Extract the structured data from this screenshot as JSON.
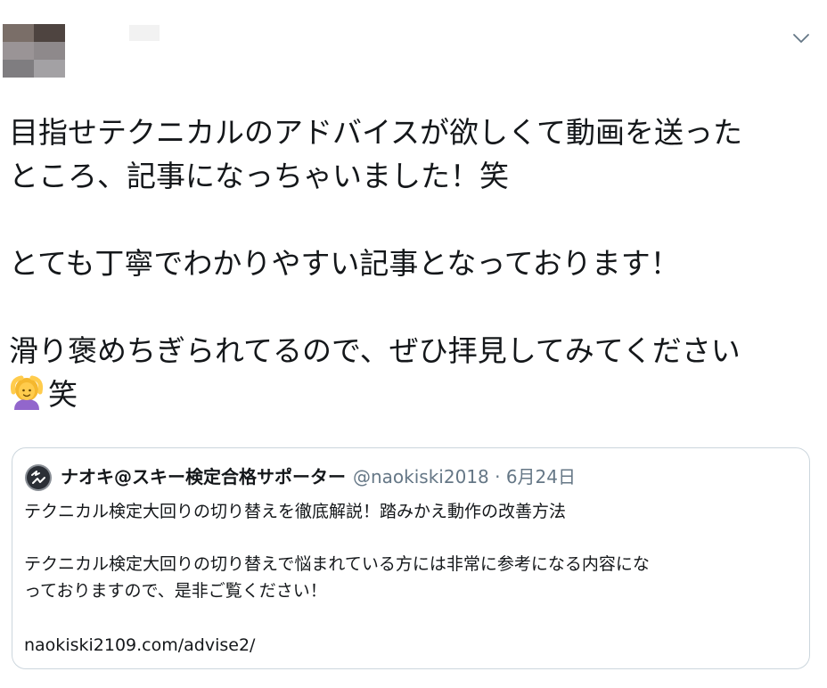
{
  "tweet": {
    "body": {
      "line1": "目指せテクニカルのアドバイスが欲しくて動画を送った",
      "line2": "ところ、記事になっちゃいました！笑",
      "line3": "とても丁寧でわかりやすい記事となっております！",
      "line4": "滑り褒めちぎられてるので、ぜひ拝見してみてください",
      "line5_text": "笑",
      "line5_emoji": "person-gesturing-ok-emoji"
    },
    "menu_icon": "chevron-down-icon",
    "colors": {
      "text": "#14171a",
      "secondary": "#657786",
      "border": "#ccd6dd"
    }
  },
  "quote": {
    "author_name": "ナオキ@スキー検定合格サポーター",
    "author_meta": "@naokiski2018 · 6月24日",
    "text_line1": "テクニカル検定大回りの切り替えを徹底解説！踏みかえ動作の改善方法",
    "text_line2": "テクニカル検定大回りの切り替えで悩まれている方には非常に参考になる内容にな",
    "text_line3": "っておりますので、是非ご覧ください！",
    "link": "naokiski2109.com/advise2/"
  }
}
